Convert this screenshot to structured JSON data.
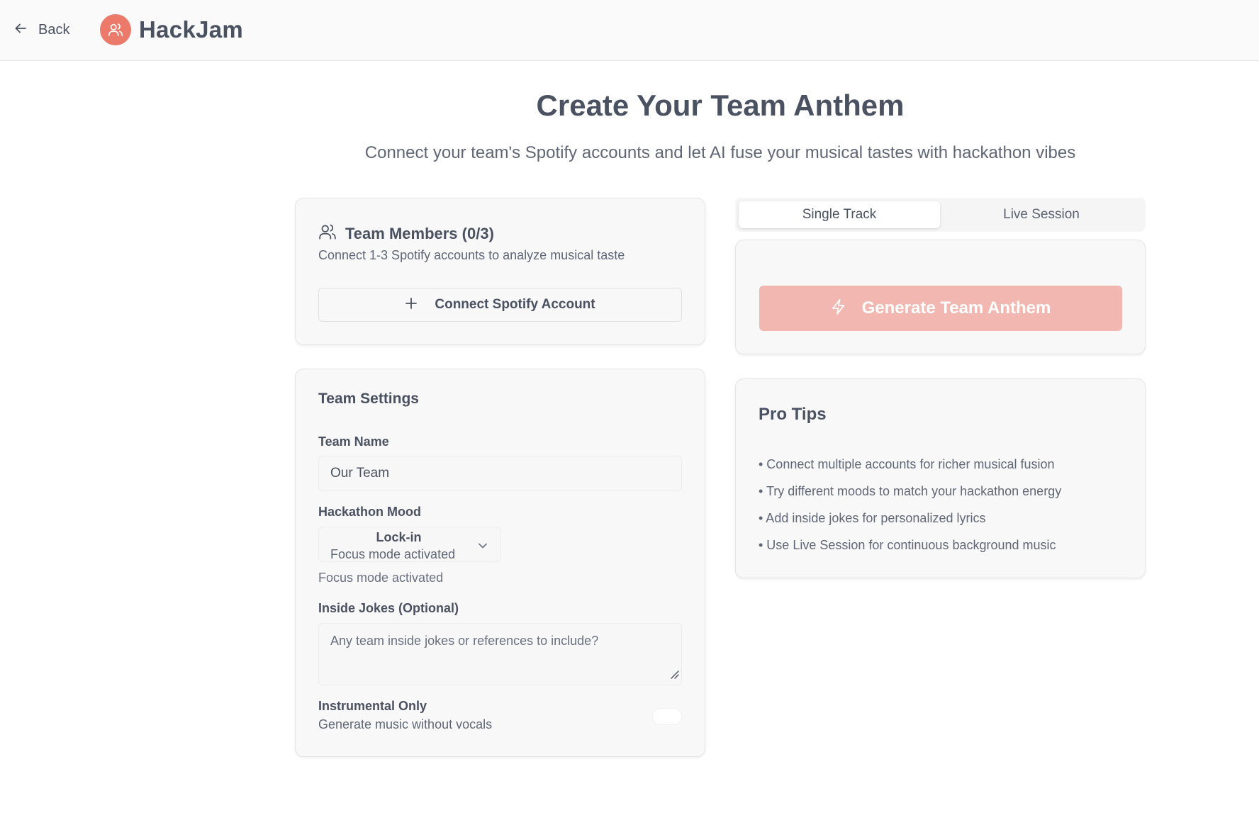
{
  "header": {
    "back_label": "Back",
    "brand": "HackJam",
    "brand_color": "#ec7a6b"
  },
  "hero": {
    "title": "Create Your Team Anthem",
    "subtitle": "Connect your team's Spotify accounts and let AI fuse your musical tastes with hackathon vibes"
  },
  "members": {
    "title": "Team Members (0/3)",
    "description": "Connect 1-3 Spotify accounts to analyze musical taste",
    "connect_label": "Connect Spotify Account"
  },
  "settings": {
    "title": "Team Settings",
    "team_name_label": "Team Name",
    "team_name_value": "Our Team",
    "mood_label": "Hackathon Mood",
    "mood_selected": "Lock-in",
    "mood_selected_desc": "Focus mode activated",
    "mood_helper": "Focus mode activated",
    "jokes_label": "Inside Jokes (Optional)",
    "jokes_placeholder": "Any team inside jokes or references to include?",
    "instrumental_label": "Instrumental Only",
    "instrumental_desc": "Generate music without vocals",
    "instrumental_on": false
  },
  "tabs": {
    "items": [
      {
        "label": "Single Track",
        "active": true
      },
      {
        "label": "Live Session",
        "active": false
      }
    ]
  },
  "generate": {
    "label": "Generate Team Anthem",
    "color": "#f2b7b0",
    "disabled": true
  },
  "tips": {
    "title": "Pro Tips",
    "items": [
      "• Connect multiple accounts for richer musical fusion",
      "• Try different moods to match your hackathon energy",
      "• Add inside jokes for personalized lyrics",
      "• Use Live Session for continuous background music"
    ]
  }
}
